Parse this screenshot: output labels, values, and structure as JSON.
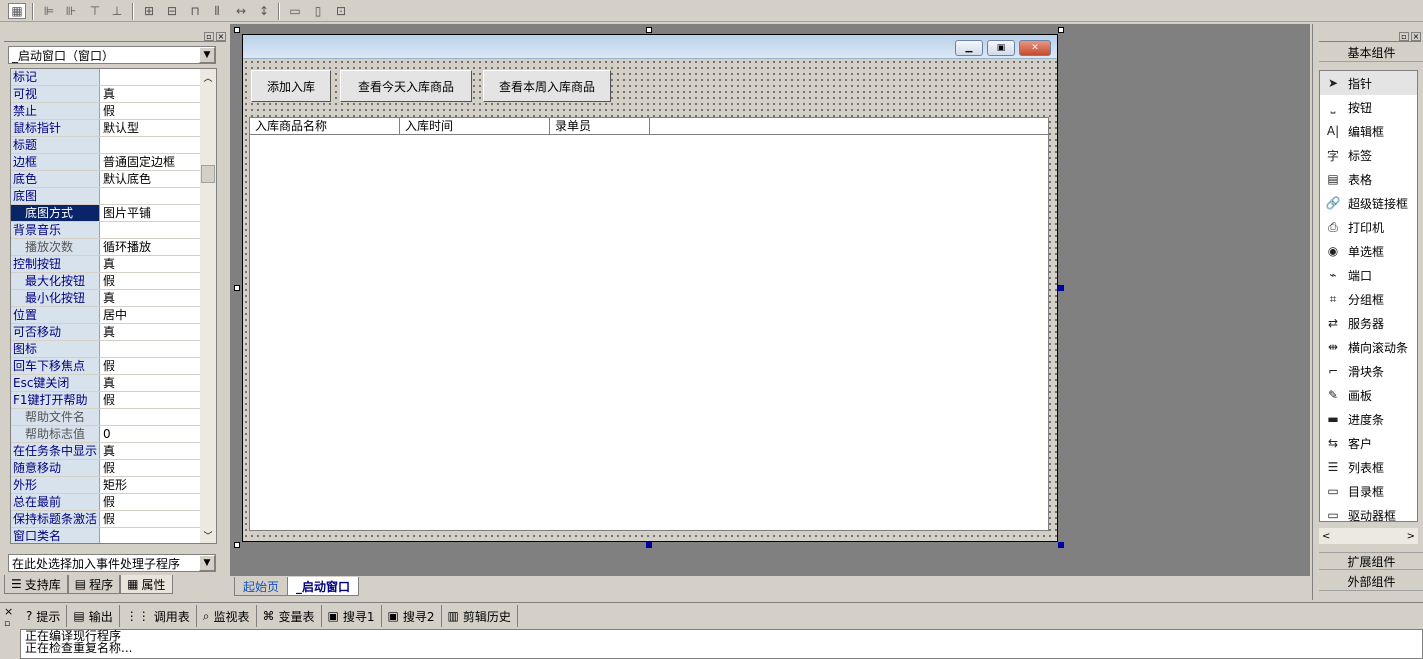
{
  "toolbar": {
    "icons": [
      "form-icon",
      "align-left-icon",
      "align-hcenter-icon",
      "align-top-icon",
      "align-vcenter-icon",
      "center-h-icon",
      "center-v-icon",
      "align-bottom-icon",
      "distribute-h-icon",
      "space-h-icon",
      "space-v-icon",
      "same-width-icon",
      "same-height-icon",
      "same-size-icon"
    ]
  },
  "props": {
    "selector": "_启动窗口（窗口）",
    "rows": [
      {
        "name": "标记",
        "value": ""
      },
      {
        "name": "可视",
        "value": "真"
      },
      {
        "name": "禁止",
        "value": "假"
      },
      {
        "name": "鼠标指针",
        "value": "默认型"
      },
      {
        "name": "标题",
        "value": ""
      },
      {
        "name": "边框",
        "value": "普通固定边框"
      },
      {
        "name": "底色",
        "value": "默认底色"
      },
      {
        "name": "底图",
        "value": ""
      },
      {
        "name": "底图方式",
        "value": "图片平铺"
      },
      {
        "name": "背景音乐",
        "value": ""
      },
      {
        "name": "播放次数",
        "value": "循环播放"
      },
      {
        "name": "控制按钮",
        "value": "真"
      },
      {
        "name": "最大化按钮",
        "value": "假"
      },
      {
        "name": "最小化按钮",
        "value": "真"
      },
      {
        "name": "位置",
        "value": "居中"
      },
      {
        "name": "可否移动",
        "value": "真"
      },
      {
        "name": "图标",
        "value": ""
      },
      {
        "name": "回车下移焦点",
        "value": "假"
      },
      {
        "name": "Esc键关闭",
        "value": "真"
      },
      {
        "name": "F1键打开帮助",
        "value": "假"
      },
      {
        "name": "帮助文件名",
        "value": ""
      },
      {
        "name": "帮助标志值",
        "value": "0"
      },
      {
        "name": "在任务条中显示",
        "value": "真"
      },
      {
        "name": "随意移动",
        "value": "假"
      },
      {
        "name": "外形",
        "value": "矩形"
      },
      {
        "name": "总在最前",
        "value": "假"
      },
      {
        "name": "保持标题条激活",
        "value": "假"
      },
      {
        "name": "窗口类名",
        "value": ""
      }
    ],
    "event_selector": "在此处选择加入事件处理子程序"
  },
  "left_tabs": [
    "支持库",
    "程序",
    "属性"
  ],
  "form": {
    "buttons": [
      "添加入库",
      "查看今天入库商品",
      "查看本周入库商品"
    ],
    "columns": [
      "入库商品名称",
      "入库时间",
      "录单员"
    ]
  },
  "designer_tabs": [
    "起始页",
    "_启动窗口"
  ],
  "components": {
    "header": "基本组件",
    "items": [
      "指针",
      "按钮",
      "编辑框",
      "标签",
      "表格",
      "超级链接框",
      "打印机",
      "单选框",
      "端口",
      "分组框",
      "服务器",
      "横向滚动条",
      "滑块条",
      "画板",
      "进度条",
      "客户",
      "列表框",
      "目录框",
      "驱动器框"
    ],
    "footer1": "扩展组件",
    "footer2": "外部组件"
  },
  "bottom_tabs": [
    "提示",
    "输出",
    "调用表",
    "监视表",
    "变量表",
    "搜寻1",
    "搜寻2",
    "剪辑历史"
  ],
  "output_lines": [
    "正在编译现行程序",
    "正在检查重复名称..."
  ]
}
